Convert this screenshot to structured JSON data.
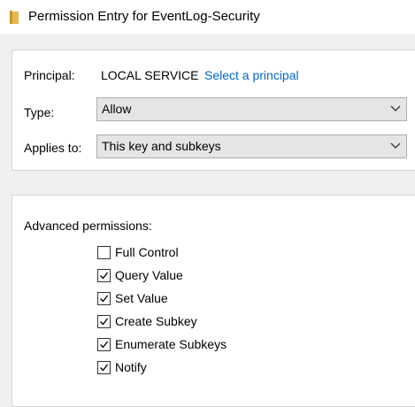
{
  "window": {
    "title": "Permission Entry for EventLog-Security",
    "icon": "folder-icon"
  },
  "principal": {
    "label": "Principal:",
    "value": "LOCAL SERVICE",
    "link": "Select a principal"
  },
  "type": {
    "label": "Type:",
    "selected": "Allow"
  },
  "applies_to": {
    "label": "Applies to:",
    "selected": "This key and subkeys"
  },
  "advanced": {
    "heading": "Advanced permissions:",
    "items": [
      {
        "label": "Full Control",
        "checked": false
      },
      {
        "label": "Query Value",
        "checked": true
      },
      {
        "label": "Set Value",
        "checked": true
      },
      {
        "label": "Create Subkey",
        "checked": true
      },
      {
        "label": "Enumerate Subkeys",
        "checked": true
      },
      {
        "label": "Notify",
        "checked": true
      }
    ]
  },
  "colors": {
    "link": "#0066cc",
    "folder": "#e8b84a"
  }
}
